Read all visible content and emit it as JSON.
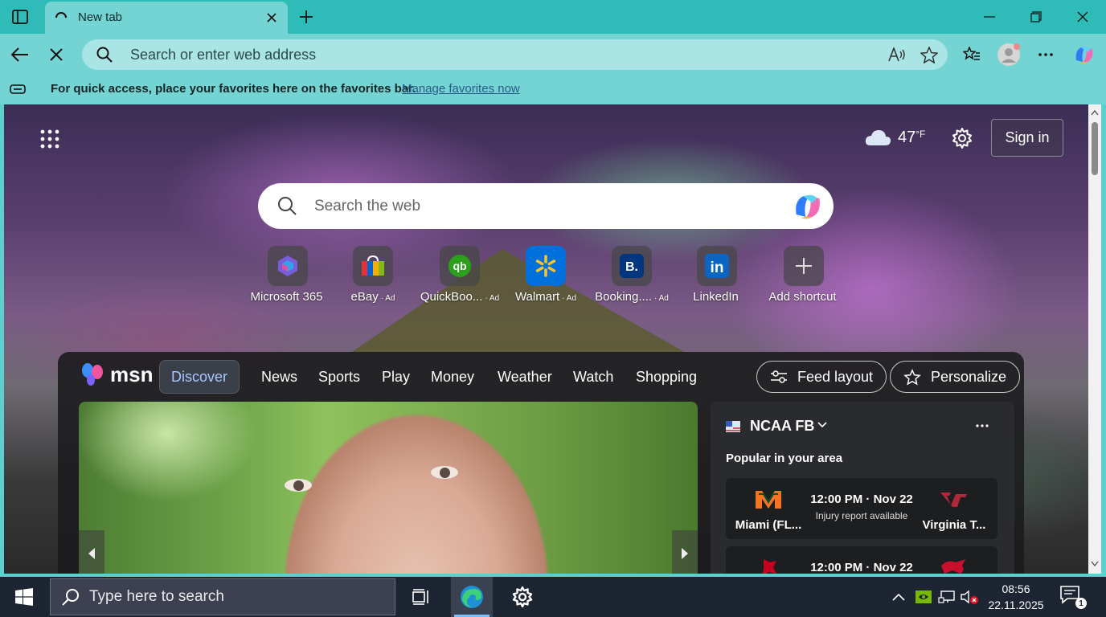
{
  "browser": {
    "tab": {
      "title": "New tab"
    },
    "address_bar": {
      "placeholder": "Search or enter web address"
    },
    "favorites_bar": {
      "message": "For quick access, place your favorites here on the favorites bar.",
      "link": "Manage favorites now"
    }
  },
  "newtab": {
    "weather": {
      "temp": "47",
      "unit": "°F"
    },
    "sign_in_label": "Sign in",
    "search_placeholder": "Search the web",
    "shortcuts": [
      {
        "label": "Microsoft 365",
        "ad": ""
      },
      {
        "label": "eBay",
        "ad": "· Ad"
      },
      {
        "label": "QuickBoo...",
        "ad": "· Ad"
      },
      {
        "label": "Walmart",
        "ad": "· Ad"
      },
      {
        "label": "Booking....",
        "ad": "· Ad"
      },
      {
        "label": "LinkedIn",
        "ad": ""
      },
      {
        "label": "Add shortcut",
        "ad": ""
      }
    ]
  },
  "feed": {
    "logo": "msn",
    "tabs": [
      "Discover",
      "News",
      "Sports",
      "Play",
      "Money",
      "Weather",
      "Watch",
      "Shopping"
    ],
    "feed_layout_label": "Feed layout",
    "personalize_label": "Personalize",
    "sports_card": {
      "title": "NCAA FB",
      "subtitle": "Popular in your area",
      "games": [
        {
          "home": "Miami (FL...",
          "away": "Virginia T...",
          "time": "12:00 PM · Nov 22",
          "note": "Injury report available"
        },
        {
          "time": "12:00 PM · Nov 22"
        }
      ]
    }
  },
  "taskbar": {
    "search_placeholder": "Type here to search",
    "time": "08:56",
    "date": "22.11.2025",
    "notification_count": "1"
  },
  "colors": {
    "chrome_teal": "#2fbcb9",
    "toolbar_teal": "#74d4d3",
    "taskbar": "#1d2432",
    "link_blue": "#2a5a8a",
    "active_tab_text": "#a6c8ff"
  }
}
